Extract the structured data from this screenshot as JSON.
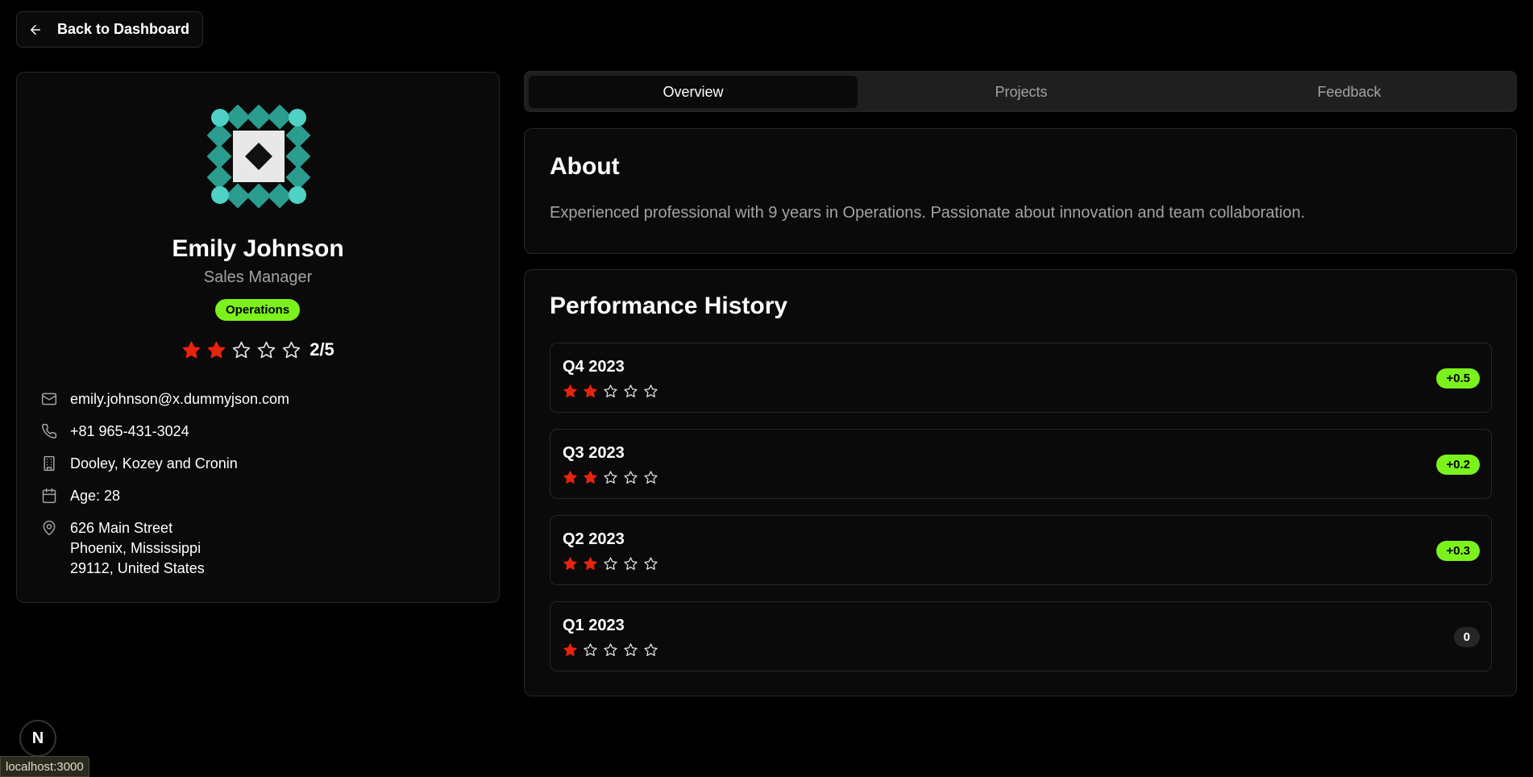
{
  "nav": {
    "back_label": "Back to Dashboard"
  },
  "profile": {
    "name": "Emily Johnson",
    "title": "Sales Manager",
    "department": "Operations",
    "rating_value": 2,
    "rating_max": 5,
    "rating_text": "2/5",
    "email": "emily.johnson@x.dummyjson.com",
    "phone": "+81 965-431-3024",
    "company": "Dooley, Kozey and Cronin",
    "age": "Age: 28",
    "address": [
      "626 Main Street",
      "Phoenix, Mississippi",
      "29112, United States"
    ]
  },
  "tabs": [
    {
      "label": "Overview",
      "active": true
    },
    {
      "label": "Projects",
      "active": false
    },
    {
      "label": "Feedback",
      "active": false
    }
  ],
  "about": {
    "heading": "About",
    "text": "Experienced professional with 9 years in Operations. Passionate about innovation and team collaboration."
  },
  "performance": {
    "heading": "Performance History",
    "items": [
      {
        "quarter": "Q4 2023",
        "rating": 2,
        "delta": "+0.5"
      },
      {
        "quarter": "Q3 2023",
        "rating": 2,
        "delta": "+0.2"
      },
      {
        "quarter": "Q2 2023",
        "rating": 2,
        "delta": "+0.3"
      },
      {
        "quarter": "Q1 2023",
        "rating": 1,
        "delta": "0"
      }
    ]
  },
  "dev_badge": {
    "letter": "N"
  },
  "status_bar": {
    "url": "localhost:3000"
  },
  "colors": {
    "accent_green": "#7cf21d",
    "star_filled": "#e8230c",
    "avatar_teal": "#26a69a"
  },
  "icons": [
    "arrow-left-icon",
    "mail-icon",
    "phone-icon",
    "building-icon",
    "calendar-icon",
    "map-pin-icon",
    "star-icon"
  ]
}
